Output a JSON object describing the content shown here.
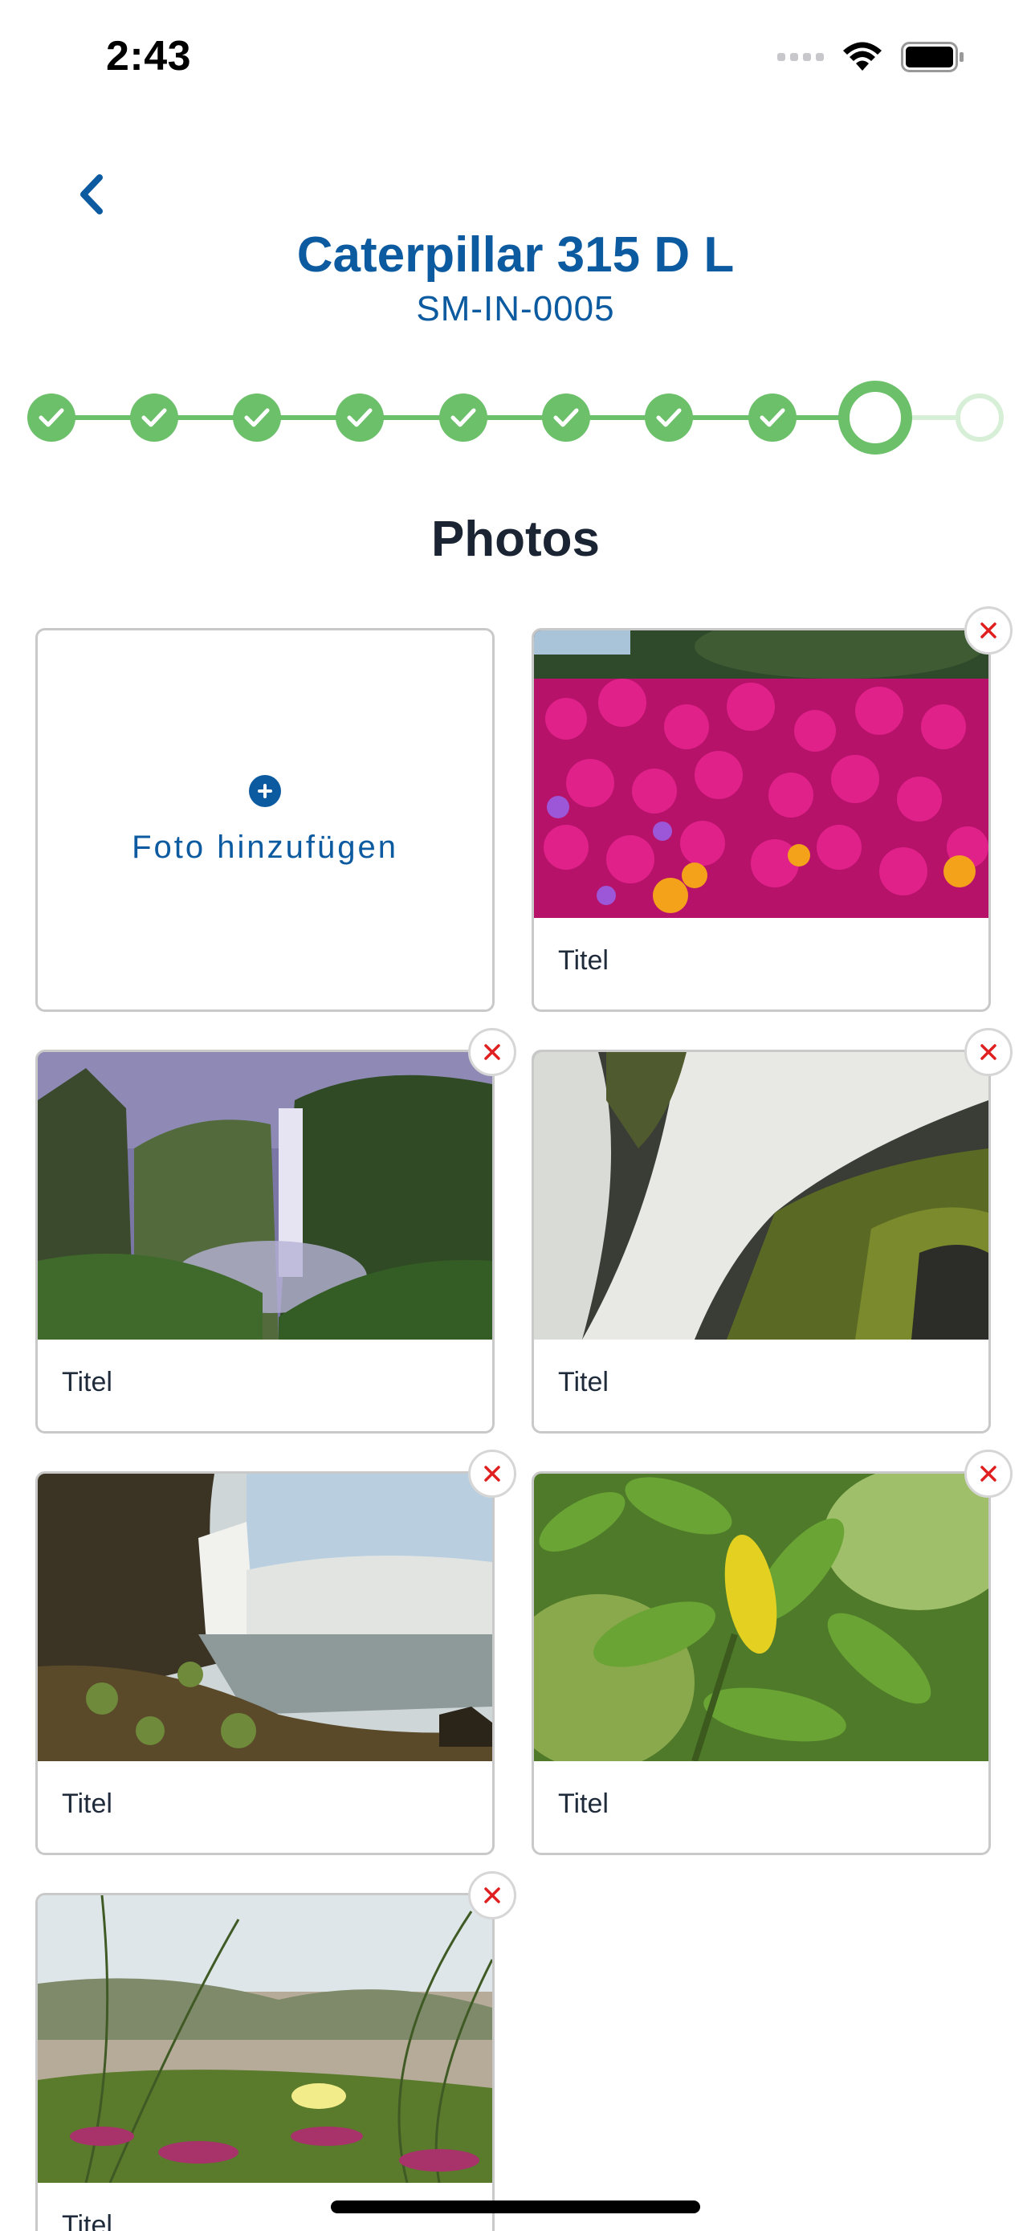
{
  "status_bar": {
    "time": "2:43"
  },
  "header": {
    "title": "Caterpillar 315 D L",
    "subtitle": "SM-IN-0005"
  },
  "stepper": {
    "total_steps": 10,
    "completed_steps": 8,
    "current_step": 9
  },
  "section": {
    "title": "Photos"
  },
  "add_photo": {
    "label": "Foto hinzufügen"
  },
  "photos": [
    {
      "caption": "Titel",
      "image": "pink flowers"
    },
    {
      "caption": "Titel",
      "image": "waterfall in valley"
    },
    {
      "caption": "Titel",
      "image": "waterfall over mossy rocks"
    },
    {
      "caption": "Titel",
      "image": "waterfall with mist"
    },
    {
      "caption": "Titel",
      "image": "green leaves"
    },
    {
      "caption": "Titel",
      "image": "dune grass with flower"
    }
  ],
  "colors": {
    "brand_blue": "#0c5aa0",
    "step_green": "#6cc06a",
    "delete_red": "#e02020"
  }
}
